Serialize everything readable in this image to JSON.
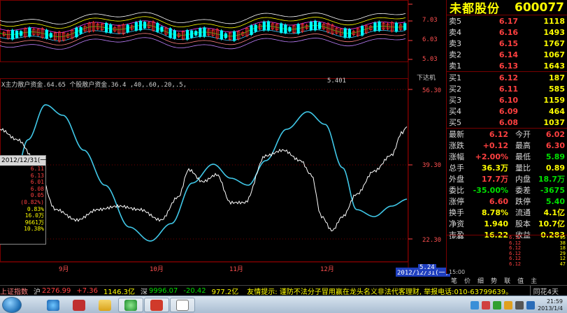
{
  "window": {
    "top_scroll_text": "...",
    "price_axis": {
      "k_top": "7.03",
      "k_mid": "6.03",
      "k_bot": "5.03",
      "k_low_label": "5.401",
      "ind_top": "56.30",
      "ind_mid": "39.30",
      "ind_bot": "22.30"
    },
    "indicator_label": "X主力散户资金.64.65  个股散户资金.36.4  ,40,.60,.20,.5,",
    "sub_label": "下达机",
    "x_axis": {
      "m1": "9月",
      "m2": "10月",
      "m3": "11月",
      "m4": "12月"
    },
    "date_box": "2012/12/31(一)",
    "date_box2": "5.24"
  },
  "data_window": {
    "title": "2012/12/31(一)",
    "rows": [
      {
        "l": "",
        "v": "6.11"
      },
      {
        "l": "",
        "v": "6.13"
      },
      {
        "l": "",
        "v": "6.01"
      },
      {
        "l": "",
        "v": "6.08"
      },
      {
        "l": "",
        "v": "0.05"
      },
      {
        "l": "",
        "v": "(0.82%)"
      },
      {
        "l": "",
        "v": "0.83%"
      },
      {
        "l": "",
        "v": "16.0万"
      },
      {
        "l": "",
        "v": "9661万"
      },
      {
        "l": "",
        "v": "10.38%"
      },
      {
        "l": "",
        "v": ""
      }
    ]
  },
  "quote": {
    "name": "未都股份",
    "code": "600077",
    "asks": [
      {
        "label": "卖5",
        "price": "6.17",
        "vol": "1118"
      },
      {
        "label": "卖4",
        "price": "6.16",
        "vol": "1493"
      },
      {
        "label": "卖3",
        "price": "6.15",
        "vol": "1767"
      },
      {
        "label": "卖2",
        "price": "6.14",
        "vol": "1067"
      },
      {
        "label": "卖1",
        "price": "6.13",
        "vol": "1643"
      }
    ],
    "bids": [
      {
        "label": "买1",
        "price": "6.12",
        "vol": "187"
      },
      {
        "label": "买2",
        "price": "6.11",
        "vol": "585"
      },
      {
        "label": "买3",
        "price": "6.10",
        "vol": "1159"
      },
      {
        "label": "买4",
        "price": "6.09",
        "vol": "464"
      },
      {
        "label": "买5",
        "price": "6.08",
        "vol": "1037"
      }
    ],
    "stats": [
      {
        "l1": "最新",
        "v1": "6.12",
        "c1": "red",
        "l2": "今开",
        "v2": "6.02",
        "c2": "red"
      },
      {
        "l1": "涨跌",
        "v1": "+0.12",
        "c1": "red",
        "l2": "最高",
        "v2": "6.30",
        "c2": "red"
      },
      {
        "l1": "涨幅",
        "v1": "+2.00%",
        "c1": "red",
        "l2": "最低",
        "v2": "5.89",
        "c2": "green"
      },
      {
        "l1": "总手",
        "v1": "36.3万",
        "c1": "yellow",
        "l2": "量比",
        "v2": "0.89",
        "c2": "yellow"
      },
      {
        "l1": "外盘",
        "v1": "17.7万",
        "c1": "red",
        "l2": "内盘",
        "v2": "18.7万",
        "c2": "green"
      },
      {
        "l1": "委比",
        "v1": "-35.00%",
        "c1": "green",
        "l2": "委差",
        "v2": "-3675",
        "c2": "green"
      },
      {
        "l1": "涨停",
        "v1": "6.60",
        "c1": "red",
        "l2": "跌停",
        "v2": "5.40",
        "c2": "green"
      },
      {
        "l1": "换手",
        "v1": "8.78%",
        "c1": "yellow",
        "l2": "流通",
        "v2": "4.1亿",
        "c2": "yellow"
      },
      {
        "l1": "净资",
        "v1": "1.940",
        "c1": "yellow",
        "l2": "股本",
        "v2": "10.7亿",
        "c2": "yellow"
      },
      {
        "l1": "市盈",
        "v1": "16.22",
        "c1": "yellow",
        "l2": "收益",
        "v2": "0.283",
        "c2": "yellow"
      }
    ],
    "ticks": [
      {
        "t": "14:55",
        "p": "6.12",
        "v": "15"
      },
      {
        "t": "",
        "p": "6.12",
        "v": "38"
      },
      {
        "t": "",
        "p": "6.12",
        "v": "18"
      },
      {
        "t": "",
        "p": "6.12",
        "v": "29"
      },
      {
        "t": "",
        "p": "6.12",
        "v": "12"
      },
      {
        "t": "",
        "p": "6.12",
        "v": "47"
      }
    ],
    "tick_time_end": "15:00",
    "tabs": [
      "笔",
      "价",
      "细",
      "势",
      "联",
      "值",
      "主"
    ]
  },
  "ticker": {
    "label1": "上证指数",
    "prefix1": "沪",
    "idx1": "2276.99",
    "chg1": "+7.36",
    "amt1": "1146.3亿",
    "label2": "深",
    "idx2": "9996.07",
    "chg2": "-20.42",
    "amt2": "977.2亿",
    "msg": "友情提示: 谨防不法分子冒用赢在龙头名义非法代客理财, 举报电话:010-63799639。",
    "right": "同花4天"
  },
  "taskbar": {
    "time": "21:59",
    "date": "2013/1/4"
  },
  "colors": {
    "candle_up": "#ff3030",
    "candle_down": "#00ffff",
    "main_line": "#40c8e8",
    "retail_line": "#ffffff",
    "grid": "#7a0000"
  }
}
